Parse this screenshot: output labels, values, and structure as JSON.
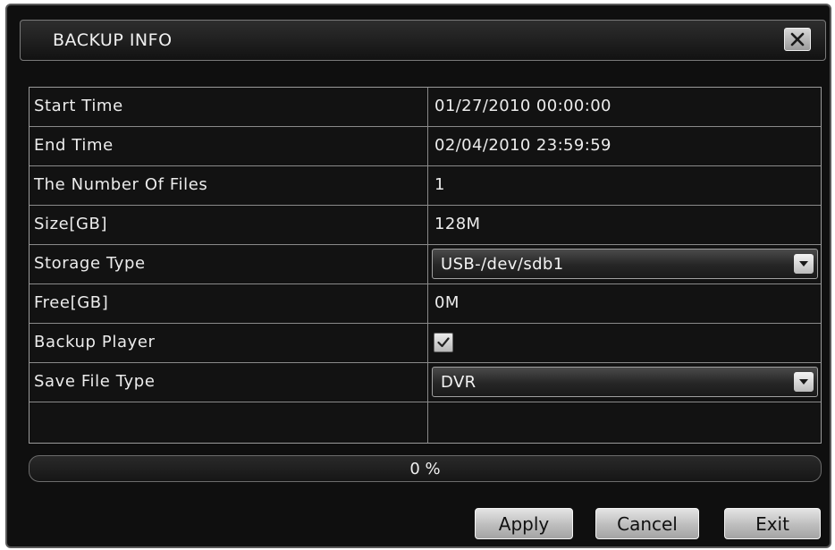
{
  "window": {
    "title": "BACKUP INFO"
  },
  "rows": [
    {
      "label": "Start Time",
      "value": "01/27/2010  00:00:00"
    },
    {
      "label": "End Time",
      "value": "02/04/2010  23:59:59"
    },
    {
      "label": "The Number Of Files",
      "value": "1"
    },
    {
      "label": "Size[GB]",
      "value": "128M"
    },
    {
      "label": "Storage Type",
      "select_value": "USB-/dev/sdb1"
    },
    {
      "label": "Free[GB]",
      "value": "0M"
    },
    {
      "label": "Backup Player",
      "checked": true
    },
    {
      "label": "Save File Type",
      "select_value": "DVR"
    }
  ],
  "progress": {
    "text": "0  %",
    "percent": 0
  },
  "buttons": {
    "apply": "Apply",
    "cancel": "Cancel",
    "exit": "Exit"
  },
  "icons": {
    "close": "close-icon",
    "dropdown": "chevron-down-icon",
    "check": "check-icon"
  },
  "colors": {
    "background": "#0f0f0f",
    "text": "#e8e8e8",
    "border": "#8a8a8a",
    "button": "#c8c8c8"
  }
}
